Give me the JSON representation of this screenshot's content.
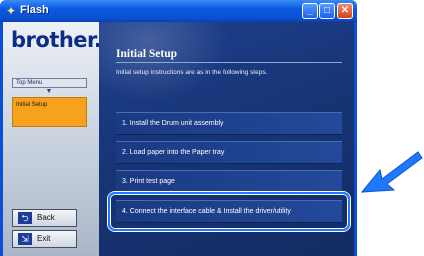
{
  "window": {
    "title": "Flash",
    "minimize": "_",
    "maximize": "□",
    "close": "✕"
  },
  "sidebar": {
    "logo": "brother.",
    "top_menu": "Top Menu",
    "current": "Initial Setup",
    "back_label": "Back",
    "exit_label": "Exit"
  },
  "main": {
    "title": "Initial Setup",
    "intro": "Initial setup instructions are as in the following steps.",
    "steps": [
      "1. Install the Drum unit assembly",
      "2. Load paper into the Paper tray",
      "3. Print test page",
      "4. Connect the interface cable & Install the driver/utility"
    ]
  },
  "colors": {
    "highlight": "#1f78ff",
    "current_item": "#f7a21e",
    "titlebar": "#0a5be0",
    "pointer_arrow": "#1f78ff"
  },
  "icons": {
    "app": "flash-icon",
    "back": "back-arrow-icon",
    "exit": "exit-icon",
    "pointer": "pointer-arrow-icon"
  }
}
